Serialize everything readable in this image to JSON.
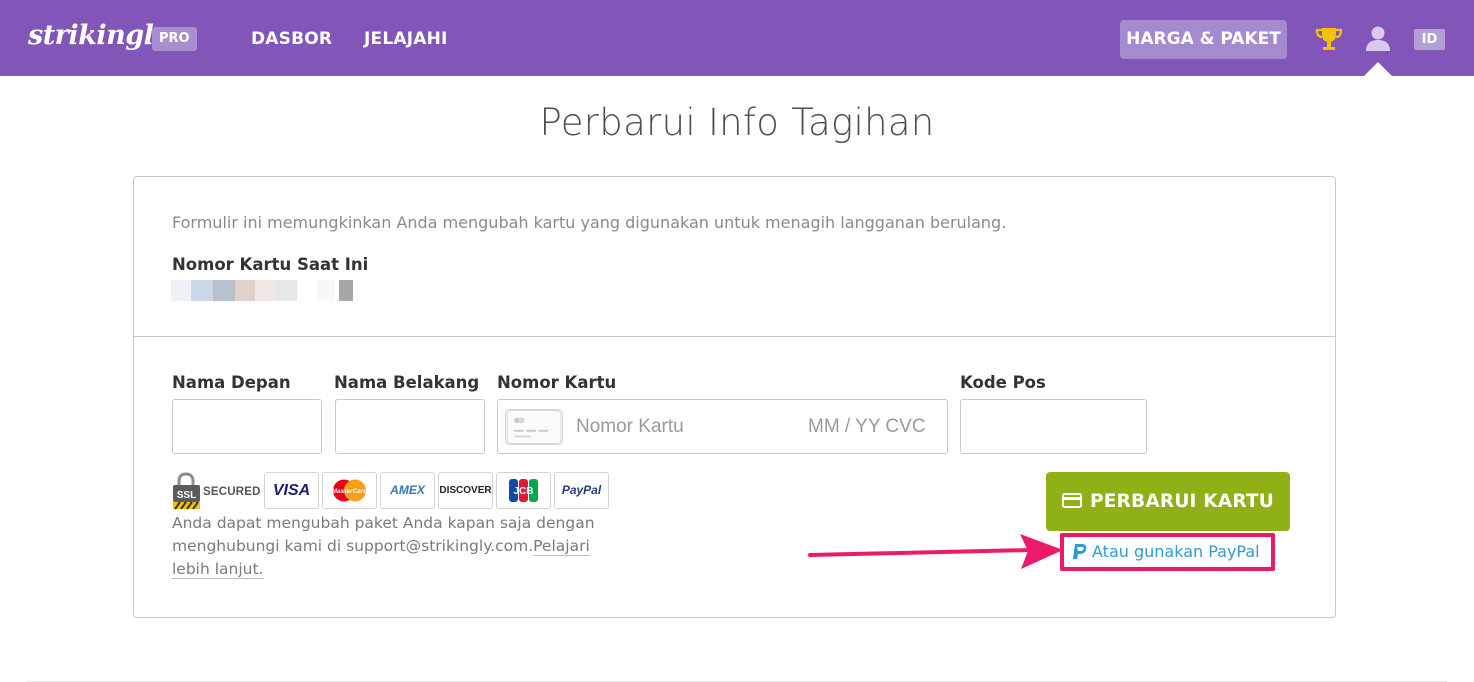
{
  "nav": {
    "logo": "strikingly",
    "pro_badge": "PRO",
    "links": [
      "DASBOR",
      "JELAJAHI"
    ],
    "pricing_button": "HARGA & PAKET",
    "language_badge": "ID"
  },
  "page": {
    "title": "Perbarui Info Tagihan"
  },
  "card": {
    "intro": "Formulir ini memungkinkan Anda mengubah kartu yang digunakan untuk menagih langganan berulang.",
    "current_card_label": "Nomor Kartu Saat Ini",
    "fields": {
      "first_name_label": "Nama Depan",
      "last_name_label": "Nama Belakang",
      "card_number_label": "Nomor Kartu",
      "card_number_placeholder": "Nomor Kartu",
      "expiry_cvc_placeholder": "MM / YY  CVC",
      "postal_code_label": "Kode Pos",
      "first_name_value": "",
      "last_name_value": "",
      "postal_code_value": ""
    },
    "ssl_label": "SECURED",
    "payment_logos": [
      "VISA",
      "MasterCard",
      "AMEX",
      "DISCOVER",
      "JCB",
      "PayPal"
    ],
    "help_text_prefix": "Anda dapat mengubah paket Anda kapan saja dengan menghubungi kami di support@strikingly.com.",
    "help_link": "Pelajari lebih lanjut.",
    "update_button": "PERBARUI KARTU",
    "paypal_link": "Atau gunakan PayPal"
  },
  "colors": {
    "nav_bg": "#8255b8",
    "accent_green": "#8fb116",
    "highlight_pink": "#ec1a69",
    "link_blue": "#2d9ad4"
  }
}
